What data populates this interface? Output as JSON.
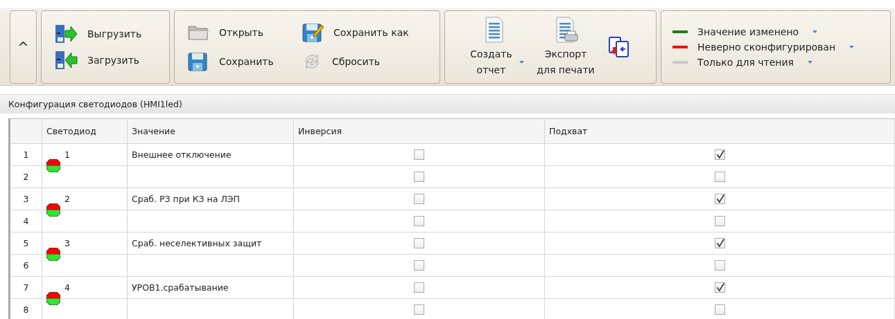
{
  "ribbon": {
    "collapse": {
      "label": "^"
    },
    "transfer": [
      {
        "label": "Выгрузить",
        "kind": "upload"
      },
      {
        "label": "Загрузить",
        "kind": "download"
      }
    ],
    "file": [
      {
        "label": "Открыть",
        "kind": "open"
      },
      {
        "label": "Сохранить",
        "kind": "save"
      },
      {
        "label": "Сохранить как",
        "kind": "saveas"
      },
      {
        "label": "Сбросить",
        "kind": "reset"
      }
    ],
    "report": [
      {
        "label": "Создать отчет",
        "kind": "report",
        "dropdown": true
      },
      {
        "label": "Экспорт для печати",
        "kind": "print",
        "dropdown": false
      },
      {
        "kind": "compare"
      }
    ],
    "legend": [
      {
        "label": "Значение изменено",
        "color": "#1a7f1a"
      },
      {
        "label": "Неверно сконфигурирован",
        "color": "#ff0000"
      },
      {
        "label": "Только для чтения",
        "color": "#c8c8c8"
      }
    ]
  },
  "panel": {
    "title": "Конфигурация светодиодов (HMI1led)"
  },
  "table": {
    "columns": [
      "Светодиод",
      "Значение",
      "Инверсия",
      "Подхват"
    ],
    "rows": [
      {
        "number": "1",
        "kind": "led-top",
        "led": "1",
        "value": "Внешнее отключение",
        "inversion": false,
        "capture": true
      },
      {
        "number": "2",
        "kind": "led-bottom",
        "inversion": false,
        "capture": false
      },
      {
        "number": "3",
        "kind": "led-top",
        "led": "2",
        "value": "Сраб. РЗ при КЗ на ЛЭП",
        "inversion": false,
        "capture": true
      },
      {
        "number": "4",
        "kind": "led-bottom",
        "inversion": false,
        "capture": false
      },
      {
        "number": "5",
        "kind": "led-top",
        "led": "3",
        "value": "Сраб. неселективных защит",
        "inversion": false,
        "capture": true
      },
      {
        "number": "6",
        "kind": "led-bottom",
        "inversion": false,
        "capture": false
      },
      {
        "number": "7",
        "kind": "led-top",
        "led": "4",
        "value": "УРОВ1.срабатывание",
        "inversion": false,
        "capture": true
      },
      {
        "number": "8",
        "kind": "led-bottom",
        "inversion": false,
        "capture": false
      }
    ]
  }
}
